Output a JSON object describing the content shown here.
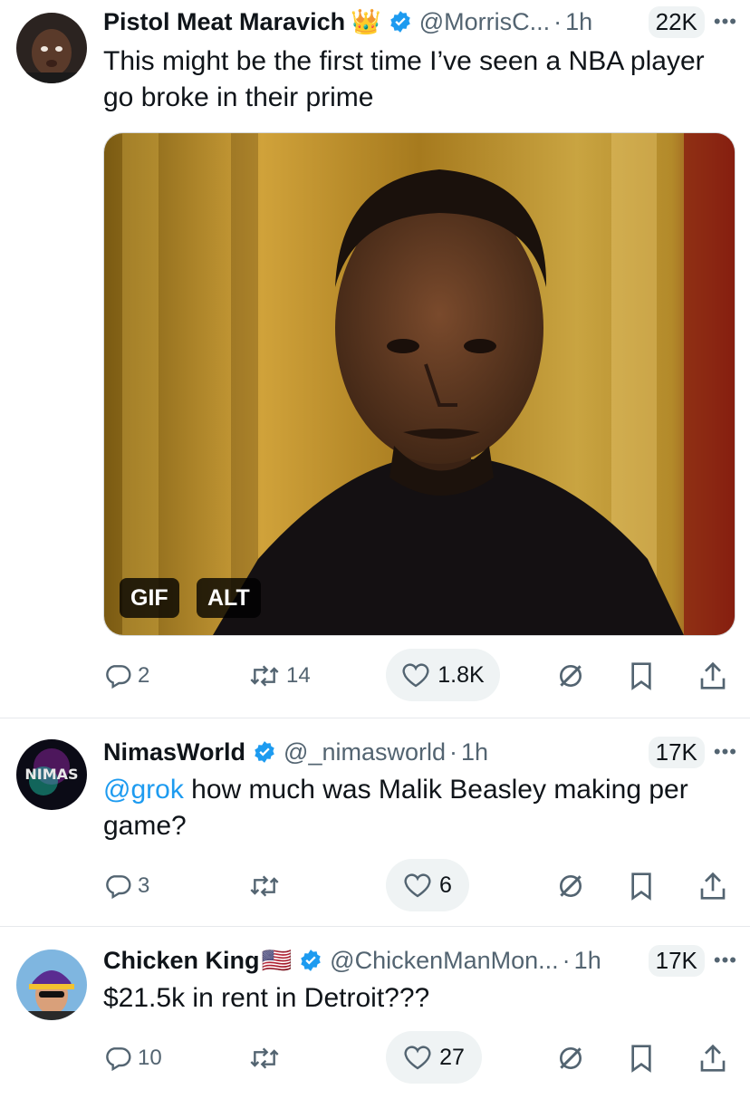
{
  "tweets": [
    {
      "name": "Pistol Meat Maravich",
      "emoji": "👑",
      "handle": "@MorrisC...",
      "time": "1h",
      "views": "22K",
      "text": "This might be the first time I’ve seen a NBA player go broke in their prime",
      "media": {
        "gif_label": "GIF",
        "alt_label": "ALT"
      },
      "replies": "2",
      "reposts": "14",
      "likes": "1.8K"
    },
    {
      "name": "NimasWorld",
      "handle": "@_nimasworld",
      "time": "1h",
      "views": "17K",
      "text_mention": "@grok",
      "text": " how much was Malik Beasley making per game?",
      "replies": "3",
      "reposts": "",
      "likes": "6"
    },
    {
      "name": "Chicken King",
      "emoji": "🇺🇸",
      "handle": "@ChickenManMon...",
      "time": "1h",
      "views": "17K",
      "text": "$21.5k in rent in Detroit???",
      "replies": "10",
      "reposts": "",
      "likes": "27"
    }
  ],
  "separator": "·",
  "icons": [
    "reply-icon",
    "repost-icon",
    "heart-icon",
    "grok-icon",
    "bookmark-icon",
    "share-icon",
    "verified-icon",
    "more-icon"
  ],
  "colors": {
    "link": "#1d9bf0",
    "secondary": "#536471",
    "pill": "#eff3f4",
    "verified": "#1d9bf0"
  }
}
